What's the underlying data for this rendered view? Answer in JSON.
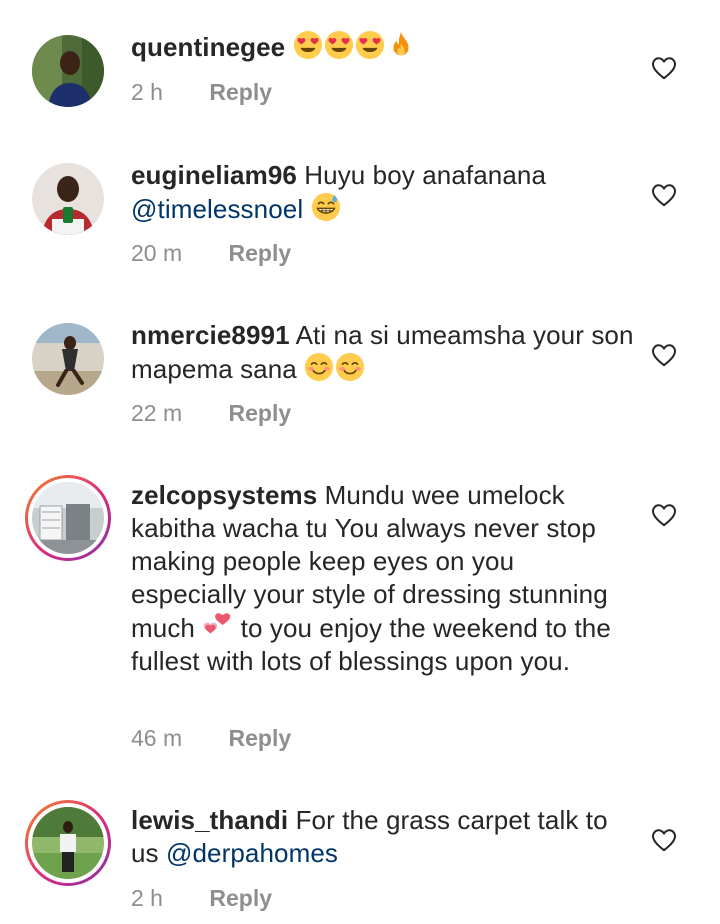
{
  "comments": [
    {
      "username": "quentinegee",
      "text": "",
      "emojis_after": [
        "heart-eyes",
        "heart-eyes",
        "heart-eyes",
        "fire"
      ],
      "time": "2 h",
      "reply_label": "Reply"
    },
    {
      "username": "eugineliam96",
      "text": "Huyu boy anafanana",
      "mention": "@timelessnoel",
      "emojis_after": [
        "grin-sweat"
      ],
      "time": "20 m",
      "reply_label": "Reply"
    },
    {
      "username": "nmercie8991",
      "text": "Ati na si umeamsha your son mapema sana",
      "emojis_after": [
        "blush",
        "blush"
      ],
      "time": "22 m",
      "reply_label": "Reply"
    },
    {
      "username": "zelcopsystems",
      "text_part1": "Mundu wee umelock kabitha wacha tu You always never stop making people keep eyes on you especially your style of dressing stunning much",
      "text_part2": "to you enjoy the weekend to the fullest with lots of blessings upon you.",
      "emoji_mid": "two-hearts",
      "time": "46 m",
      "reply_label": "Reply"
    },
    {
      "username": "lewis_thandi",
      "text": "For the grass carpet talk to us",
      "mention": "@derpahomes",
      "time": "2 h",
      "reply_label": "Reply"
    }
  ],
  "colors": {
    "text": "#262626",
    "muted": "#8e8e8e",
    "mention": "#003569",
    "story_ring_start": "#f58529",
    "story_ring_end": "#8134af"
  },
  "icons": {
    "like": "heart-outline-icon"
  }
}
